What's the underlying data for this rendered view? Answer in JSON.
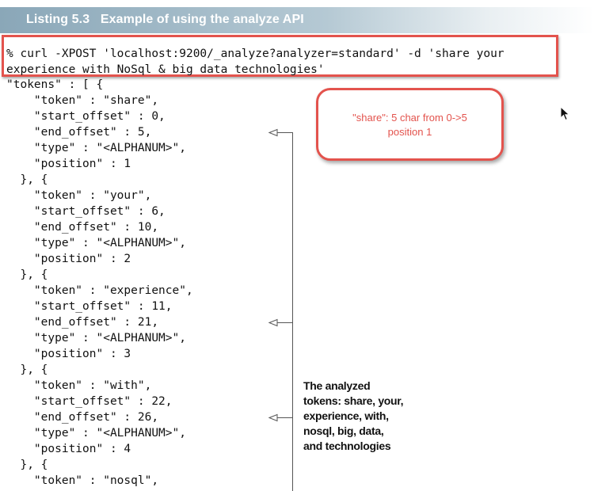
{
  "listing": {
    "title": "Listing 5.3   Example of using the analyze API"
  },
  "command": {
    "lines": [
      "% curl -XPOST 'localhost:9200/_analyze?analyzer=standard' -d 'share your",
      "experience with NoSql & big data technologies'"
    ]
  },
  "output": {
    "lines": [
      "\"tokens\" : [ {",
      "    \"token\" : \"share\",",
      "    \"start_offset\" : 0,",
      "    \"end_offset\" : 5,",
      "    \"type\" : \"<ALPHANUM>\",",
      "    \"position\" : 1",
      "  }, {",
      "    \"token\" : \"your\",",
      "    \"start_offset\" : 6,",
      "    \"end_offset\" : 10,",
      "    \"type\" : \"<ALPHANUM>\",",
      "    \"position\" : 2",
      "  }, {",
      "    \"token\" : \"experience\",",
      "    \"start_offset\" : 11,",
      "    \"end_offset\" : 21,",
      "    \"type\" : \"<ALPHANUM>\",",
      "    \"position\" : 3",
      "  }, {",
      "    \"token\" : \"with\",",
      "    \"start_offset\" : 22,",
      "    \"end_offset\" : 26,",
      "    \"type\" : \"<ALPHANUM>\",",
      "    \"position\" : 4",
      "  }, {",
      "    \"token\" : \"nosql\","
    ]
  },
  "callout": {
    "lines": [
      "\"share\": 5 char from 0->5",
      "position 1"
    ]
  },
  "annotation": {
    "lines": [
      "The analyzed",
      "tokens: share, your,",
      "experience, with,",
      "nosql, big, data,",
      "and technologies"
    ]
  },
  "colors": {
    "highlight": "#e3534d",
    "header_band": "#8aa7b8"
  },
  "icons": {
    "cursor": "mouse-pointer-icon"
  }
}
